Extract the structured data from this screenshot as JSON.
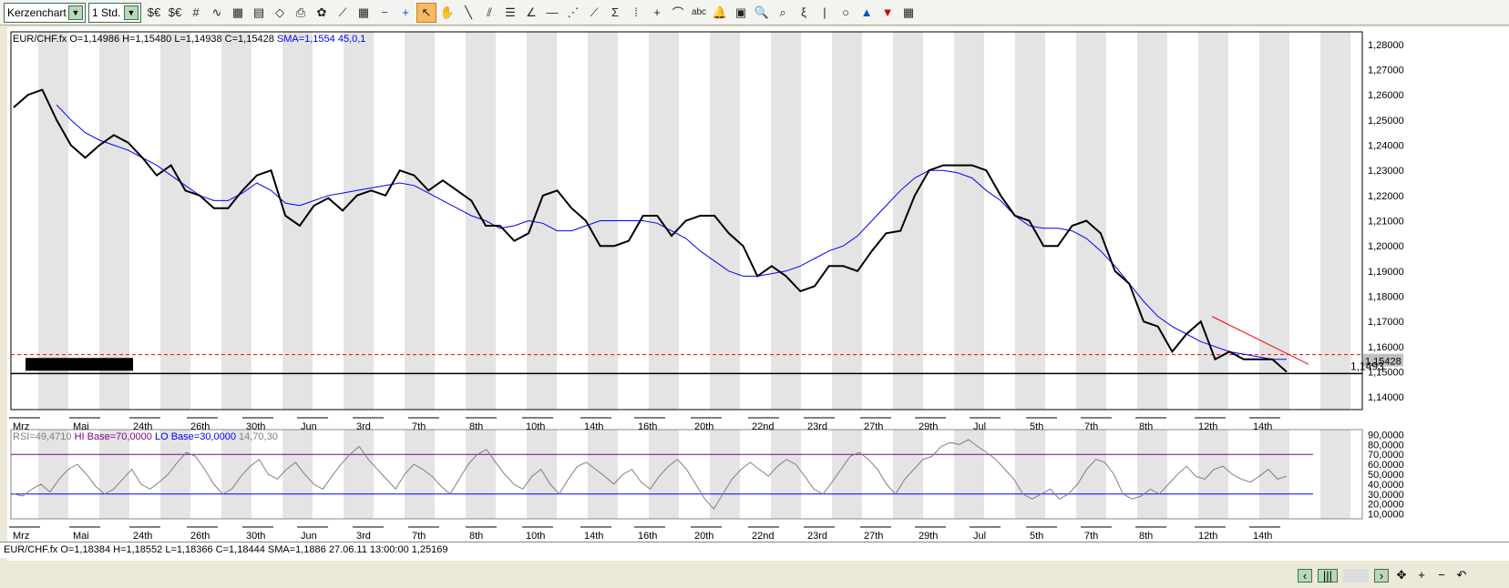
{
  "toolbar": {
    "chart_type": "Kerzenchart",
    "timeframe": "1 Std.",
    "icons": [
      "dollar-euro-icon",
      "dollar-euro-2-icon",
      "grid-icon",
      "indicator-icon",
      "chart-data-icon",
      "chart-bar-icon",
      "open-icon",
      "print-icon",
      "color-icon",
      "drawing-icon",
      "keyboard-icon",
      "zoom-out-minus-icon",
      "zoom-in-plus-icon",
      "cursor-icon",
      "hand-icon",
      "line-icon",
      "parallel-icon",
      "fib-icon",
      "fan-icon",
      "hline-icon",
      "speed-icon",
      "regression-icon",
      "channel-icon",
      "vlines-icon",
      "crosshair-icon",
      "arc-icon",
      "text-icon",
      "alarm-icon",
      "calculator-icon",
      "zoom-icon",
      "zoom-rect-icon",
      "wave-icon",
      "vline-icon",
      "circle-icon",
      "arrow-up-icon",
      "arrow-down-icon",
      "palette-icon"
    ],
    "text_label": "abc"
  },
  "main": {
    "legend": {
      "symbol": "EUR/CHF.fx",
      "ohlc": "O=1,14986 H=1,15480 L=1,14938 C=1,15428",
      "sma": "SMA=1,1554  45,0,1"
    },
    "last_price": "1,15428",
    "support_label": "1,1493",
    "price_ticks": [
      "1,28000",
      "1,27000",
      "1,26000",
      "1,25000",
      "1,24000",
      "1,23000",
      "1,22000",
      "1,21000",
      "1,20000",
      "1,19000",
      "1,18000",
      "1,17000",
      "1,16000",
      "1,15000",
      "1,14000"
    ]
  },
  "rsi": {
    "legend": {
      "rsi": "RSI=49,4710",
      "hi": "HI Base=70,0000",
      "lo": "LO Base=30,0000",
      "params": "14,70,30"
    },
    "ticks": [
      "90,0000",
      "80,0000",
      "70,0000",
      "60,0000",
      "50,0000",
      "40,0000",
      "30,0000",
      "20,0000",
      "10,0000"
    ]
  },
  "date_labels": [
    "Mrz",
    "Mai",
    "24th",
    "26th",
    "30th",
    "Jun",
    "3rd",
    "7th",
    "8th",
    "10th",
    "14th",
    "16th",
    "20th",
    "22nd",
    "23rd",
    "27th",
    "29th",
    "Jul",
    "5th",
    "7th",
    "8th",
    "12th",
    "14th"
  ],
  "status": "EUR/CHF.fx O=1,18384 H=1,18552 L=1,18366 C=1,18444  SMA=1,1886  27.06.11 13:00:00 1,25169",
  "colors": {
    "price": "#000000",
    "sma": "#0000ff",
    "trend": "#ff0000",
    "hi": "#800080",
    "lo": "#0000ff",
    "rsi": "#808080",
    "band": "#e4e4e4"
  },
  "chart_data": {
    "type": "line",
    "ylim": [
      1.135,
      1.285
    ],
    "series": [
      {
        "name": "EUR/CHF",
        "values": [
          1.255,
          1.26,
          1.262,
          1.25,
          1.24,
          1.235,
          1.24,
          1.244,
          1.241,
          1.235,
          1.228,
          1.232,
          1.222,
          1.22,
          1.215,
          1.215,
          1.222,
          1.228,
          1.23,
          1.212,
          1.208,
          1.216,
          1.219,
          1.214,
          1.22,
          1.222,
          1.22,
          1.23,
          1.228,
          1.222,
          1.226,
          1.222,
          1.218,
          1.208,
          1.208,
          1.202,
          1.205,
          1.22,
          1.222,
          1.215,
          1.21,
          1.2,
          1.2,
          1.202,
          1.212,
          1.212,
          1.204,
          1.21,
          1.212,
          1.212,
          1.205,
          1.2,
          1.188,
          1.192,
          1.188,
          1.182,
          1.184,
          1.192,
          1.192,
          1.19,
          1.198,
          1.205,
          1.206,
          1.22,
          1.23,
          1.232,
          1.232,
          1.232,
          1.23,
          1.22,
          1.212,
          1.21,
          1.2,
          1.2,
          1.208,
          1.21,
          1.205,
          1.19,
          1.185,
          1.17,
          1.168,
          1.158,
          1.165,
          1.17,
          1.155,
          1.158,
          1.155,
          1.155,
          1.155,
          1.15
        ]
      },
      {
        "name": "SMA 45",
        "values": [
          null,
          null,
          null,
          1.256,
          1.25,
          1.245,
          1.242,
          1.24,
          1.238,
          1.235,
          1.232,
          1.228,
          1.224,
          1.22,
          1.218,
          1.218,
          1.221,
          1.225,
          1.222,
          1.217,
          1.216,
          1.218,
          1.22,
          1.221,
          1.222,
          1.223,
          1.224,
          1.225,
          1.224,
          1.221,
          1.218,
          1.215,
          1.212,
          1.21,
          1.207,
          1.208,
          1.21,
          1.209,
          1.206,
          1.206,
          1.208,
          1.21,
          1.21,
          1.21,
          1.21,
          1.209,
          1.206,
          1.203,
          1.198,
          1.194,
          1.19,
          1.188,
          1.188,
          1.189,
          1.19,
          1.192,
          1.195,
          1.198,
          1.2,
          1.204,
          1.21,
          1.216,
          1.222,
          1.227,
          1.23,
          1.23,
          1.229,
          1.227,
          1.222,
          1.218,
          1.212,
          1.208,
          1.207,
          1.207,
          1.206,
          1.203,
          1.198,
          1.192,
          1.185,
          1.178,
          1.172,
          1.168,
          1.165,
          1.162,
          1.16,
          1.158,
          1.157,
          1.156,
          1.155,
          1.155
        ]
      },
      {
        "name": "RSI",
        "values": [
          30,
          28,
          35,
          40,
          32,
          45,
          55,
          60,
          50,
          38,
          30,
          35,
          45,
          55,
          40,
          35,
          42,
          50,
          62,
          72,
          68,
          55,
          40,
          30,
          35,
          48,
          58,
          65,
          50,
          45,
          55,
          62,
          50,
          40,
          35,
          48,
          60,
          70,
          78,
          65,
          55,
          45,
          35,
          50,
          60,
          55,
          48,
          38,
          30,
          45,
          60,
          70,
          75,
          62,
          50,
          40,
          35,
          48,
          55,
          40,
          30,
          45,
          58,
          62,
          55,
          48,
          40,
          50,
          55,
          42,
          35,
          48,
          58,
          65,
          55,
          40,
          25,
          15,
          30,
          45,
          55,
          62,
          55,
          48,
          58,
          65,
          60,
          48,
          35,
          30,
          42,
          55,
          68,
          72,
          65,
          55,
          40,
          30,
          45,
          55,
          65,
          68,
          78,
          82,
          80,
          85,
          78,
          72,
          65,
          55,
          45,
          30,
          25,
          30,
          35,
          25,
          30,
          40,
          55,
          65,
          62,
          50,
          30,
          25,
          28,
          35,
          30,
          40,
          50,
          58,
          48,
          45,
          55,
          58,
          50,
          45,
          42,
          48,
          55,
          45,
          48
        ]
      }
    ],
    "trendline": [
      1.172,
      1.153
    ],
    "support": 1.1493,
    "hi_base": 70,
    "lo_base": 30
  }
}
